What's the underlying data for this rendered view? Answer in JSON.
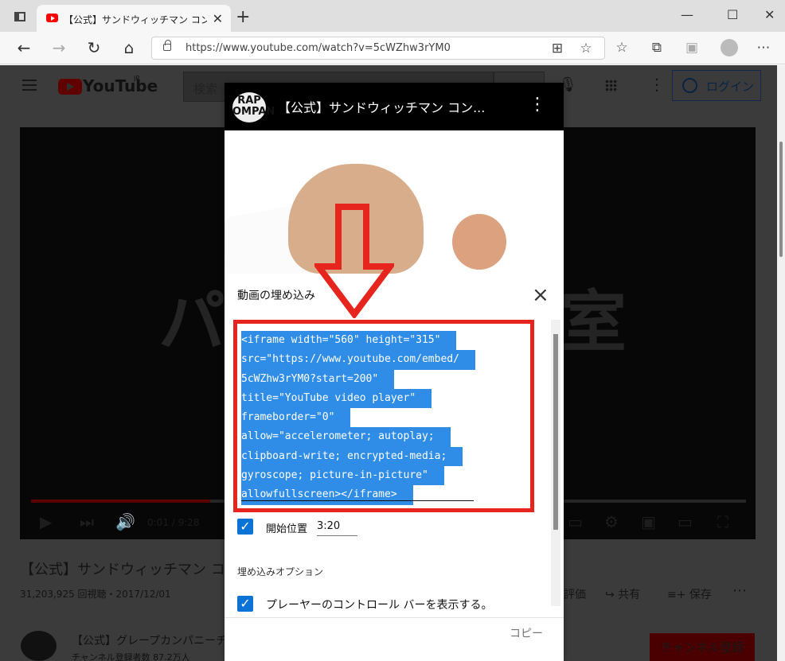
{
  "browser": {
    "tab_title": "【公式】サンドウィッチマン コント【パソコ",
    "url": "https://www.youtube.com/watch?v=5cWZhw3rYM0",
    "new_tab": "+",
    "close": "✕",
    "minimize": "—",
    "restore": "☐",
    "window_close": "✕"
  },
  "youtube": {
    "logo_text": "YouTube",
    "region": "JP",
    "search_placeholder": "検索",
    "login": "ログイン",
    "video_title": "【公式】サンドウィッチマン コ",
    "views": "31,203,925 回視聴・2017/12/01",
    "like": "評価",
    "share": "共有",
    "save": "保存",
    "channel_name": "【公式】グレープカンパニーチ",
    "channel_subscribers": "チャンネル登録者数 87.2万人",
    "subscribe": "チャンネル登録",
    "time": "0:01 / 9:28",
    "background_words": [
      "パ",
      "室"
    ],
    "progress": 0.25
  },
  "mini_player": {
    "logo_text": "RAP\nOMPAN",
    "title": "【公式】サンドウィッチマン コン...",
    "more": "⋮"
  },
  "embed_dialog": {
    "title": "動画の埋め込み",
    "code_lines": [
      "<iframe width=\"560\" height=\"315\"",
      "src=\"https://www.youtube.com/embed/",
      "5cWZhw3rYM0?start=200\"",
      "title=\"YouTube video player\"",
      "frameborder=\"0\"",
      "allow=\"accelerometer; autoplay;",
      "clipboard-write; encrypted-media;",
      "gyroscope; picture-in-picture\"",
      "allowfullscreen></iframe>"
    ],
    "start_label": "開始位置",
    "start_value": "3:20",
    "options_title": "埋め込みオプション",
    "control_option": "プレーヤーのコントロール バーを表示する。",
    "copy": "コピー"
  },
  "colors": {
    "highlight": "#2f8de8",
    "frame": "#e5251e",
    "checkbox": "#0b73d5",
    "youtube_red": "#ff0000"
  },
  "icons": [
    "sidebar-icon",
    "youtube-favicon",
    "back-icon",
    "forward-icon",
    "refresh-icon",
    "home-icon",
    "lock-icon",
    "search-icon",
    "mic-icon",
    "apps-icon",
    "more-icon",
    "user-icon",
    "play-icon",
    "next-icon",
    "volume-icon",
    "settings-icon",
    "miniplayer-icon",
    "theater-icon",
    "fullscreen-icon",
    "close-icon",
    "check-icon",
    "red-arrow-icon"
  ]
}
